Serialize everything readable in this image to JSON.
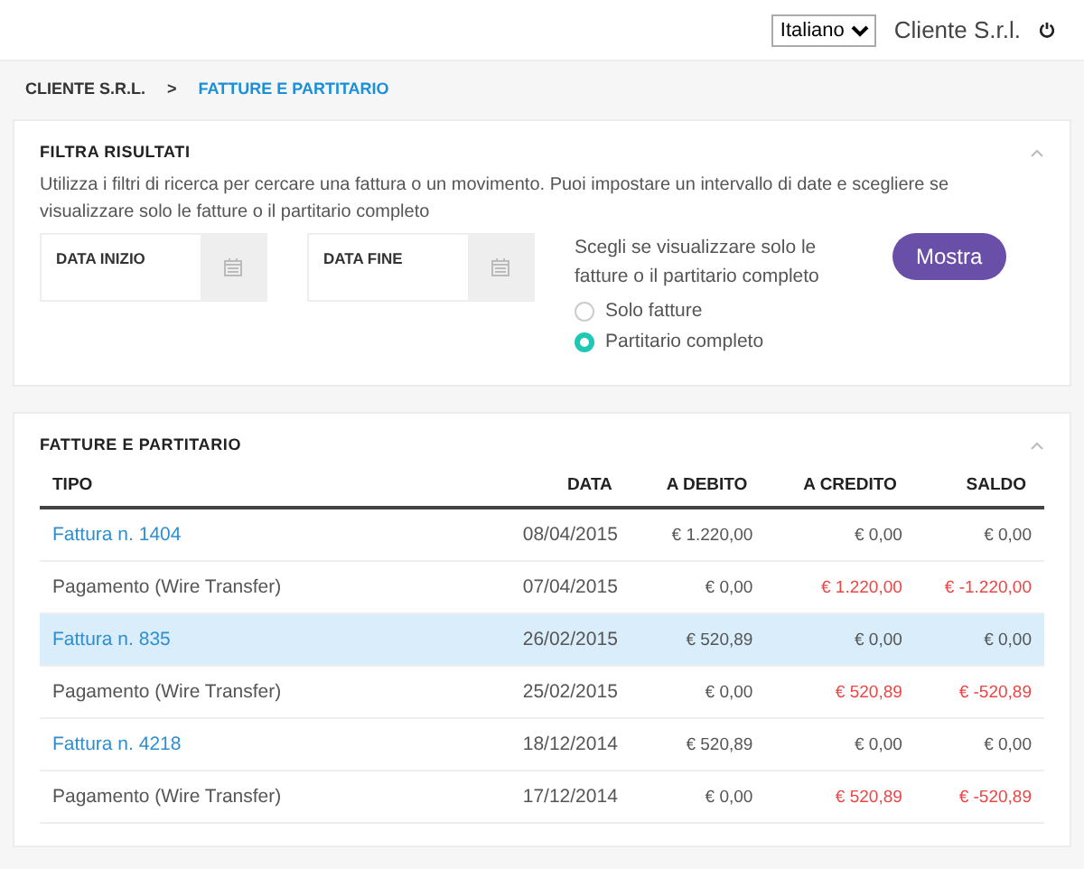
{
  "header": {
    "language": {
      "value": "Italiano"
    },
    "user": "Cliente S.r.l."
  },
  "breadcrumb": [
    {
      "label": "CLIENTE S.R.L.",
      "selected": false
    },
    {
      "label": "FATTURE E PARTITARIO",
      "selected": true
    }
  ],
  "breadcrumb_separator": ">",
  "filter": {
    "title": "FILTRA RISULTATI",
    "expanded": true,
    "description": "Utilizza i filtri di ricerca per cercare una fattura o un movimento. Puoi impostare un intervallo di date e scegliere se visualizzare solo le fatture o il partitario completo",
    "date_fields": [
      {
        "label": "DATA INIZIO"
      },
      {
        "label": "DATA FINE"
      }
    ],
    "choice_label": "Scegli se visualizzare solo le fatture o il partitario completo",
    "options": [
      {
        "label": "Solo fatture",
        "selected": false
      },
      {
        "label": "Partitario completo",
        "selected": true
      }
    ],
    "button": "Mostra"
  },
  "ledger": {
    "title": "FATTURE E PARTITARIO",
    "expanded": true,
    "columns": [
      "TIPO",
      "DATA",
      "A DEBITO",
      "A CREDITO",
      "SALDO"
    ],
    "rows": [
      {
        "kind": "invoice",
        "selected": false,
        "cells": [
          "Fattura n. 1404",
          "08/04/2015",
          "€ 1.220,00",
          "€ 0,00",
          "€ 0,00"
        ]
      },
      {
        "kind": "payment",
        "selected": false,
        "cells": [
          "Pagamento (Wire Transfer)",
          "07/04/2015",
          "€ 0,00",
          "€ 1.220,00",
          "€ -1.220,00"
        ]
      },
      {
        "kind": "invoice",
        "selected": true,
        "cells": [
          "Fattura n. 835",
          "26/02/2015",
          "€ 520,89",
          "€ 0,00",
          "€ 0,00"
        ]
      },
      {
        "kind": "payment",
        "selected": false,
        "cells": [
          "Pagamento (Wire Transfer)",
          "25/02/2015",
          "€ 0,00",
          "€ 520,89",
          "€ -520,89"
        ]
      },
      {
        "kind": "invoice",
        "selected": false,
        "cells": [
          "Fattura n. 4218",
          "18/12/2014",
          "€ 520,89",
          "€ 0,00",
          "€ 0,00"
        ]
      },
      {
        "kind": "payment",
        "selected": false,
        "cells": [
          "Pagamento (Wire Transfer)",
          "17/12/2014",
          "€ 0,00",
          "€ 520,89",
          "€ -520,89"
        ]
      }
    ]
  }
}
